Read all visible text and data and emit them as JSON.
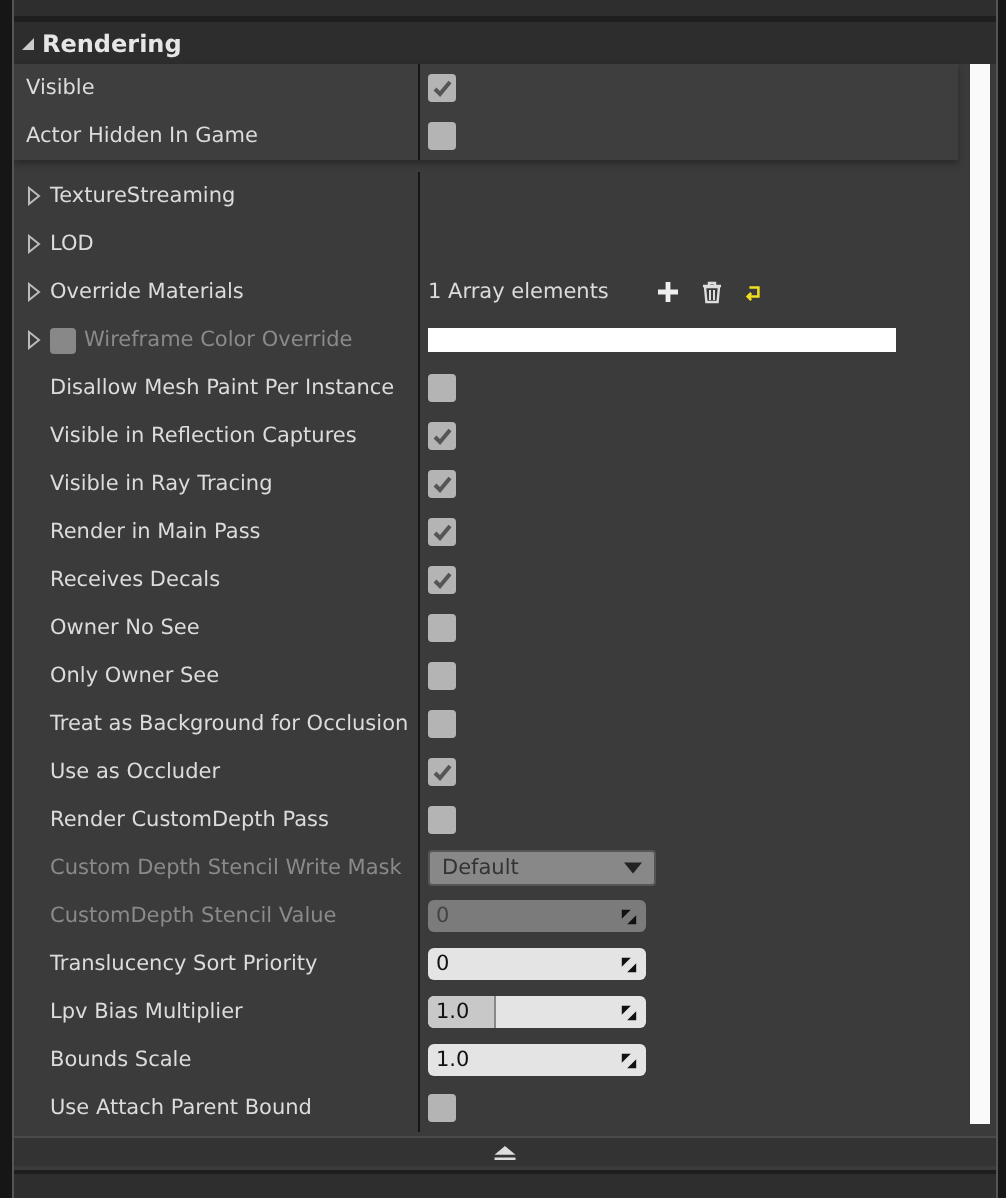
{
  "section": {
    "title": "Rendering",
    "expanded": true
  },
  "basic_rows": [
    {
      "kind": "checkbox",
      "label": "Visible",
      "checked": true
    },
    {
      "kind": "checkbox",
      "label": "Actor Hidden In Game",
      "checked": false
    }
  ],
  "advanced_rows": [
    {
      "kind": "group",
      "label": "TextureStreaming"
    },
    {
      "kind": "group",
      "label": "LOD"
    },
    {
      "kind": "array",
      "label": "Override Materials",
      "value": "1 Array elements"
    },
    {
      "kind": "color",
      "label": "Wireframe Color Override",
      "disabled": true,
      "checked": false
    },
    {
      "kind": "checkbox",
      "label": "Disallow Mesh Paint Per Instance",
      "checked": false
    },
    {
      "kind": "checkbox",
      "label": "Visible in Reflection Captures",
      "checked": true
    },
    {
      "kind": "checkbox",
      "label": "Visible in Ray Tracing",
      "checked": true
    },
    {
      "kind": "checkbox",
      "label": "Render in Main Pass",
      "checked": true
    },
    {
      "kind": "checkbox",
      "label": "Receives Decals",
      "checked": true
    },
    {
      "kind": "checkbox",
      "label": "Owner No See",
      "checked": false
    },
    {
      "kind": "checkbox",
      "label": "Only Owner See",
      "checked": false
    },
    {
      "kind": "checkbox",
      "label": "Treat as Background for Occlusion",
      "checked": false
    },
    {
      "kind": "checkbox",
      "label": "Use as Occluder",
      "checked": true
    },
    {
      "kind": "checkbox",
      "label": "Render CustomDepth Pass",
      "checked": false
    },
    {
      "kind": "dropdown",
      "label": "Custom Depth Stencil Write Mask",
      "value": "Default",
      "disabled": true
    },
    {
      "kind": "number",
      "label": "CustomDepth Stencil Value",
      "value": "0",
      "disabled": true
    },
    {
      "kind": "number",
      "label": "Translucency Sort Priority",
      "value": "0",
      "disabled": false
    },
    {
      "kind": "slider",
      "label": "Lpv Bias Multiplier",
      "value": "1.0",
      "level": 0.3
    },
    {
      "kind": "number",
      "label": "Bounds Scale",
      "value": "1.0",
      "disabled": false
    },
    {
      "kind": "checkbox",
      "label": "Use Attach Parent Bound",
      "checked": false
    }
  ]
}
